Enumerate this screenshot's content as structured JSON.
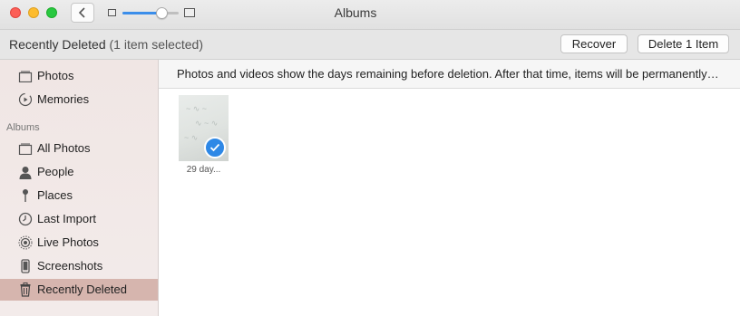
{
  "window": {
    "title": "Albums"
  },
  "toolbar": {
    "slider_level": 0.75
  },
  "header": {
    "title": "Recently Deleted",
    "selection": "(1 item selected)",
    "recover_label": "Recover",
    "delete_label": "Delete 1 Item"
  },
  "sidebar": {
    "top_items": [
      {
        "label": "Photos",
        "icon": "photos-icon"
      },
      {
        "label": "Memories",
        "icon": "memories-icon"
      }
    ],
    "albums_header": "Albums",
    "album_items": [
      {
        "label": "All Photos",
        "icon": "all-photos-icon"
      },
      {
        "label": "People",
        "icon": "person-icon"
      },
      {
        "label": "Places",
        "icon": "pin-icon"
      },
      {
        "label": "Last Import",
        "icon": "clock-icon"
      },
      {
        "label": "Live Photos",
        "icon": "live-photos-icon"
      },
      {
        "label": "Screenshots",
        "icon": "phone-icon"
      },
      {
        "label": "Recently Deleted",
        "icon": "trash-icon",
        "selected": true
      }
    ]
  },
  "content": {
    "info": "Photos and videos show the days remaining before deletion. After that time, items will be permanently deleted.",
    "items": [
      {
        "caption": "29 day...",
        "selected": true
      }
    ]
  },
  "colors": {
    "selection_bg": "#d6b5ae",
    "accent": "#2e88e6",
    "sidebar_bg": "#f0e6e4"
  }
}
